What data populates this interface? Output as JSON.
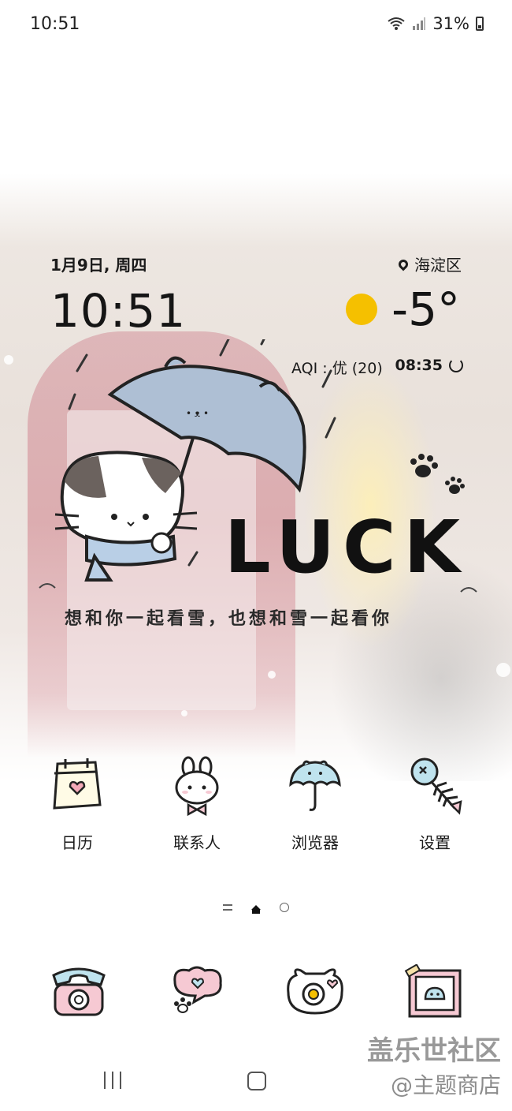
{
  "status_bar": {
    "time": "10:51",
    "battery": "31%"
  },
  "widget": {
    "date": "1月9日, 周四",
    "location": "海淀区",
    "clock": "10:51",
    "temperature": "-5°",
    "aqi": "AQI : 优 (20)",
    "update_time": "08:35"
  },
  "artwork": {
    "title": "LUCK",
    "slogan": "想和你一起看雪，也想和雪一起看你"
  },
  "apps": [
    {
      "label": "日历",
      "icon": "calendar-icon"
    },
    {
      "label": "联系人",
      "icon": "bunny-icon"
    },
    {
      "label": "浏览器",
      "icon": "umbrella-icon"
    },
    {
      "label": "设置",
      "icon": "fishbone-icon"
    }
  ],
  "dock": [
    {
      "icon": "phone-icon"
    },
    {
      "icon": "message-icon"
    },
    {
      "icon": "camera-icon"
    },
    {
      "icon": "gallery-icon"
    }
  ],
  "watermark": {
    "title": "盖乐世社区",
    "subtitle": "@主题商店"
  },
  "colors": {
    "sun": "#f5c000",
    "booth": "#d79aa0",
    "icon_pink": "#f6c9d3",
    "icon_blue": "#bfe3ee"
  }
}
